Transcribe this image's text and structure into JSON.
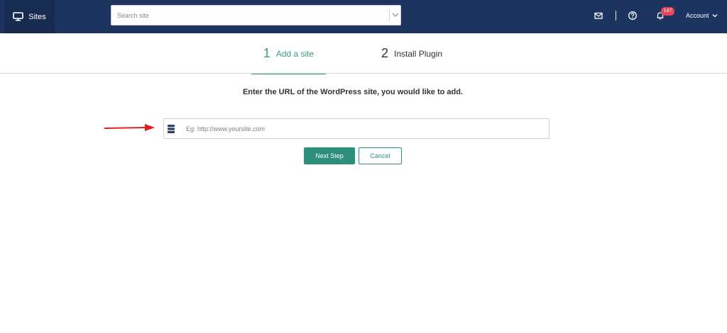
{
  "topbar": {
    "brand_label": "Sites",
    "search_placeholder": "Search site",
    "notification_count": "147",
    "account_label": "Account"
  },
  "steps": [
    {
      "number": "1",
      "label": "Add a site"
    },
    {
      "number": "2",
      "label": "Install Plugin"
    }
  ],
  "main": {
    "instruction": "Enter the URL of the WordPress site, you would like to add.",
    "url_placeholder": "Eg: http://www.yoursite.com",
    "next_label": "Next Step",
    "cancel_label": "Cancel"
  },
  "colors": {
    "topbar": "#1d3461",
    "accent": "#2e8f7c",
    "badge": "#e8475a",
    "arrow": "#e0201b"
  }
}
